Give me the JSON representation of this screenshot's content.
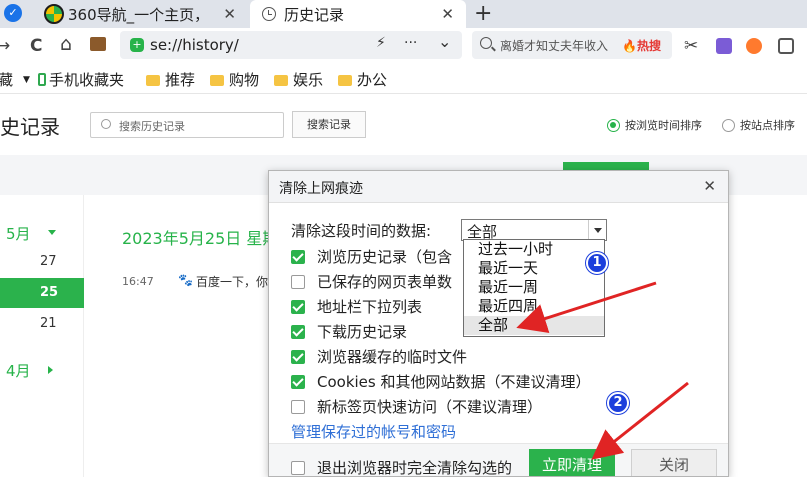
{
  "tabs": [
    {
      "title": "360导航_一个主页，",
      "close": "✕"
    },
    {
      "title": "历史记录",
      "close": "✕"
    }
  ],
  "nav": {
    "back": "→",
    "reload": "C",
    "home": "⌂",
    "url": "se://history/",
    "menu": "···",
    "expand": "⌄",
    "search_query": "离婚才知丈夫年收入",
    "hot_label": "热搜"
  },
  "bookmarks": {
    "partial": "藏",
    "mobile": "手机收藏夹",
    "folders": [
      "推荐",
      "购物",
      "娱乐",
      "办公"
    ]
  },
  "page": {
    "title": "史记录",
    "search_placeholder": "搜索历史记录",
    "search_button": "搜索记录",
    "sort_by_time": "按浏览时间排序",
    "sort_by_site": "按站点排序"
  },
  "sidebar": {
    "month_may": "5月",
    "days": [
      "27",
      "25",
      "21"
    ],
    "month_april": "4月"
  },
  "history": {
    "date_heading": "2023年5月25日 星期",
    "entry_time": "16:47",
    "entry_title": "百度一下，你"
  },
  "dialog": {
    "title": "清除上网痕迹",
    "close": "✕",
    "period_label": "清除这段时间的数据:",
    "period_value": "全部",
    "options": [
      {
        "label": "浏览历史记录（包含",
        "checked": true
      },
      {
        "label": "已保存的网页表单数",
        "checked": false
      },
      {
        "label": "地址栏下拉列表",
        "checked": true
      },
      {
        "label": "下载历史记录",
        "checked": true
      },
      {
        "label": "浏览器缓存的临时文件",
        "checked": true
      },
      {
        "label": "Cookies 和其他网站数据（不建议清理）",
        "checked": true
      },
      {
        "label": "新标签页快速访问（不建议清理）",
        "checked": false
      }
    ],
    "manage_link": "管理保存过的帐号和密码",
    "exit_clear": "退出浏览器时完全清除勾选的",
    "clear_button": "立即清理",
    "cancel_button": "关闭"
  },
  "dropdown": {
    "options": [
      "过去一小时",
      "最近一天",
      "最近一周",
      "最近四周",
      "全部"
    ],
    "selected": "全部"
  },
  "annotations": {
    "badge1": "1",
    "badge2": "2"
  },
  "colors": {
    "accent": "#2bb24c",
    "link": "#2f6fd6",
    "annotation_arrow": "#e02424",
    "badge": "#1c3fdc"
  }
}
